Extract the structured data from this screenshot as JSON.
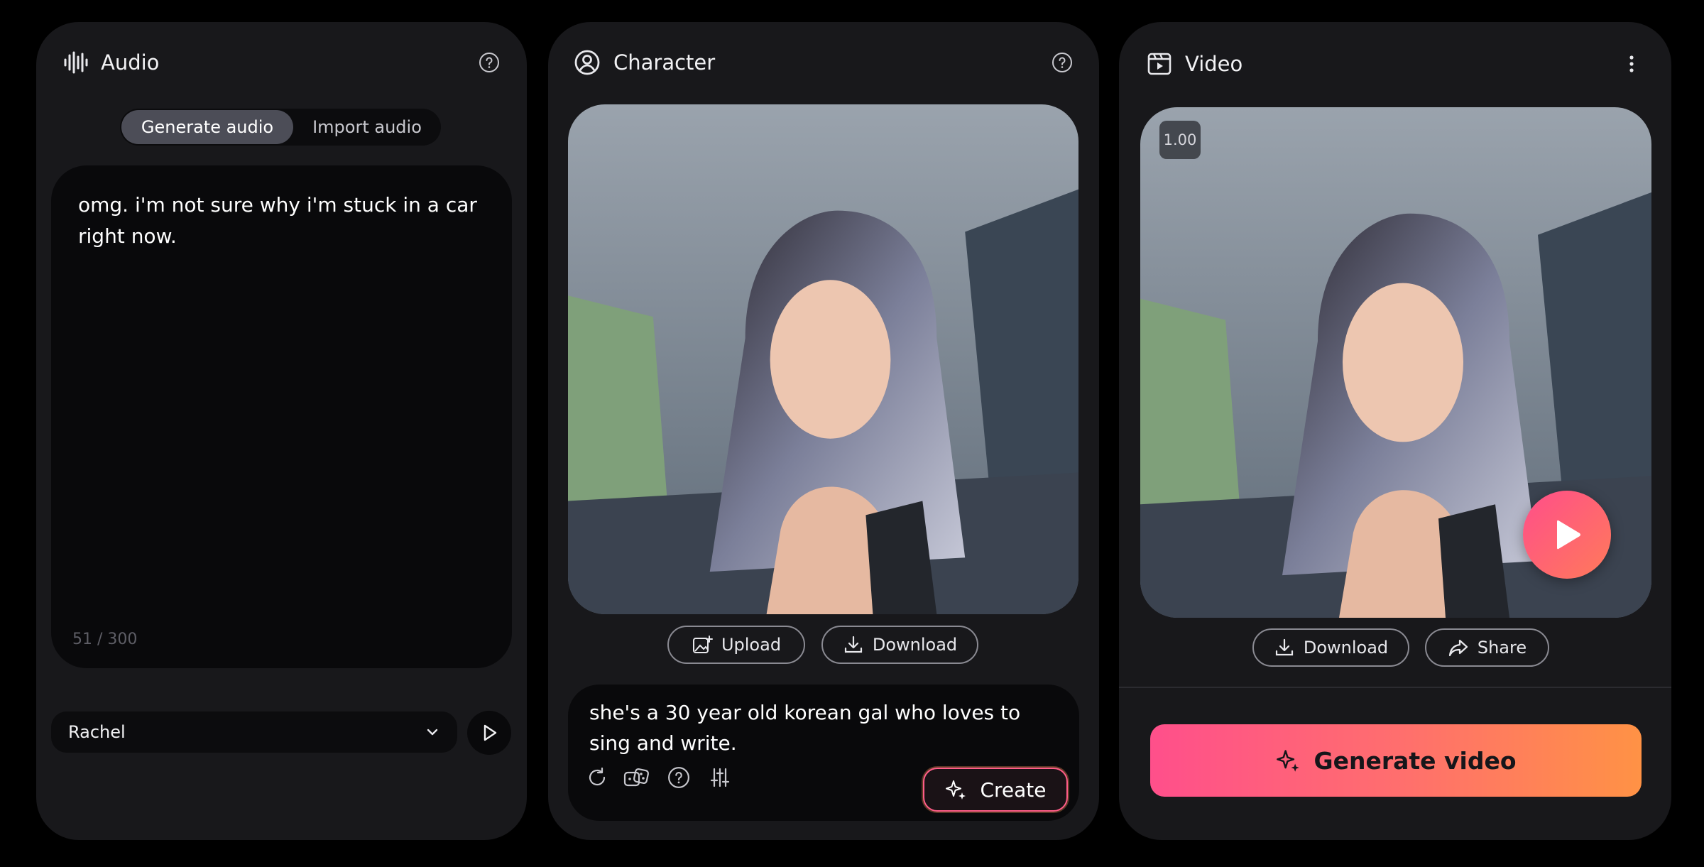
{
  "audio": {
    "title": "Audio",
    "tabs": [
      "Generate audio",
      "Import audio"
    ],
    "text": "omg. i'm not sure why i'm stuck in a car right now.",
    "counter": "51 / 300",
    "voice": "Rachel",
    "icons": {
      "header": "waveform-icon",
      "help": "help-icon",
      "dropdown": "chevron-down-icon",
      "play": "play-icon"
    }
  },
  "character": {
    "title": "Character",
    "upload_label": "Upload",
    "download_label": "Download",
    "prompt": "she's a 30 year old korean gal who loves to sing and write.",
    "create_label": "Create",
    "tools": [
      "refresh-icon",
      "dice-icon",
      "help-icon",
      "sliders-icon"
    ],
    "icons": {
      "header": "user-circle-icon",
      "help": "help-icon"
    }
  },
  "video": {
    "title": "Video",
    "speed": "1.00",
    "download_label": "Download",
    "share_label": "Share",
    "generate_label": "Generate video",
    "icons": {
      "header": "film-icon",
      "menu": "more-vertical-icon",
      "play": "play-icon"
    }
  },
  "colors": {
    "panel": "#18181b",
    "inset": "#09090b",
    "accent_start": "#ff4f8b",
    "accent_end": "#ff9245"
  }
}
